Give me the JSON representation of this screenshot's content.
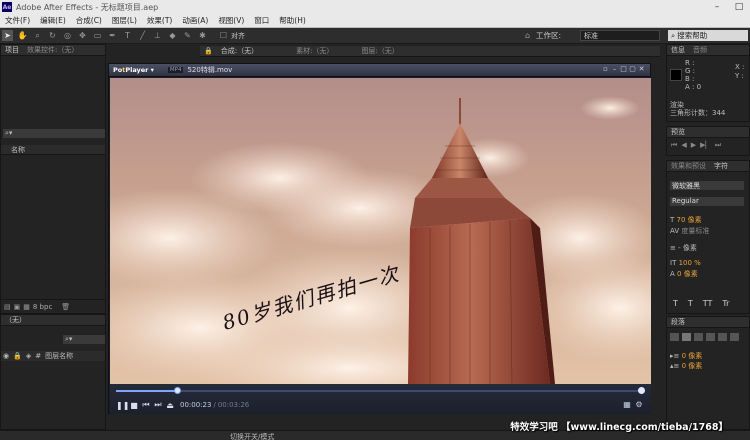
{
  "app": {
    "title": "Adobe After Effects - 无标题项目.aep",
    "logo_text": "Ae"
  },
  "menu": [
    "文件(F)",
    "编辑(E)",
    "合成(C)",
    "图层(L)",
    "效果(T)",
    "动画(A)",
    "视图(V)",
    "窗口",
    "帮助(H)"
  ],
  "toolbar": {
    "align_label": "对齐",
    "workspace_label": "工作区:",
    "workspace_value": "标准",
    "search_help": "搜索帮助"
  },
  "tabs": {
    "project": "项目",
    "effect_controls": "效果控件:（无）",
    "composition": "合成:（无）",
    "footage": "素材:（无）",
    "layer": "图层:（无）",
    "info": "信息",
    "audio": "音频",
    "preview": "预览",
    "effects_presets": "效果和预设",
    "character": "字符",
    "paragraph": "段落"
  },
  "project_panel": {
    "name_column": "名称",
    "bpc": "8 bpc"
  },
  "timeline": {
    "tab": "（无）",
    "layer_name_col": "图层名称",
    "toggle_label": "切换开关/模式"
  },
  "info_panel": {
    "r": "R :",
    "g": "G :",
    "b": "B :",
    "a": "A : 0",
    "x": "X :",
    "y": "Y :",
    "render_label": "渲染",
    "triangle_count": "三角形计数：344"
  },
  "character_panel": {
    "font": "微软雅黑",
    "style": "Regular",
    "size": "70 像素",
    "tracking": "度量标准",
    "leading_unit": "- 像素",
    "scale": "100 %",
    "baseline": "0 像素",
    "t_buttons": [
      "T",
      "T",
      "TT",
      "Tr"
    ]
  },
  "paragraph_panel": {
    "indent_left": "0 像素",
    "indent_right": "0 像素",
    "space_before": "0 像素",
    "space_after": "0 像素"
  },
  "player": {
    "logo_a": "Po",
    "logo_b": "t",
    "logo_c": "Player",
    "format": "MP4",
    "filename": "520特辑.mov",
    "time_current": "00:00:23",
    "time_sep": "/",
    "time_total": "00:03:26",
    "progress": 0.115,
    "volume": 0.92,
    "video_caption": "80岁我们再拍一次"
  },
  "watermark": "特效学习吧 【www.linecg.com/tieba/1768】",
  "colors": {
    "ae_purple": "#d59fff",
    "potplayer_accent": "#7ea6ff",
    "panel_bg": "#232323"
  }
}
